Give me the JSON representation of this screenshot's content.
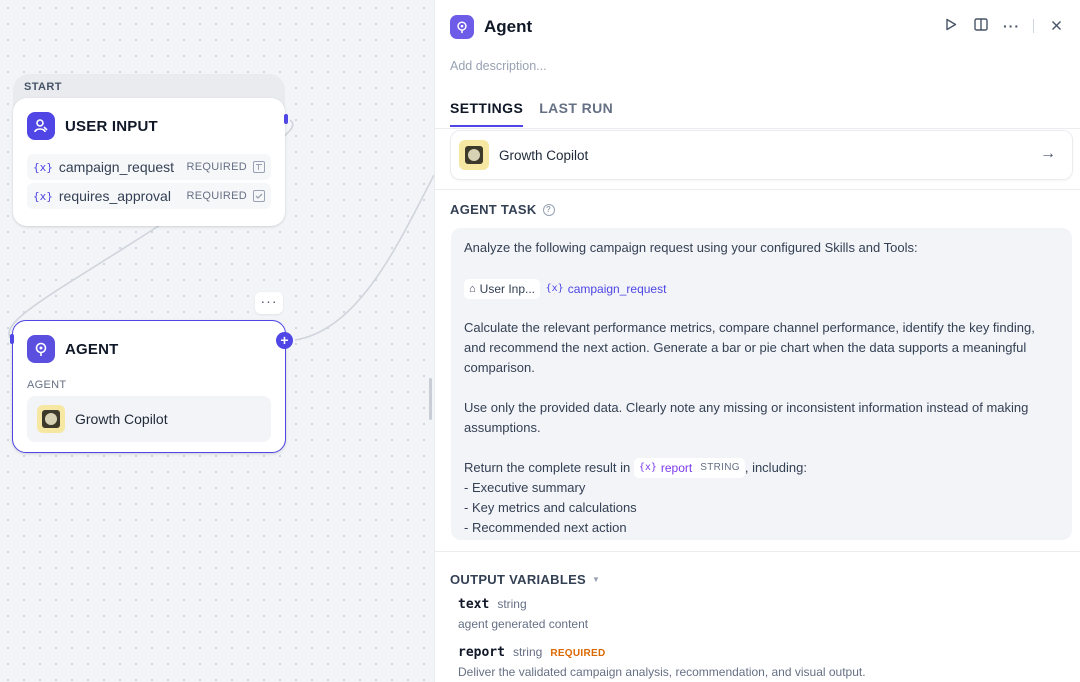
{
  "canvas": {
    "start_node": {
      "section_label": "START",
      "title": "USER INPUT",
      "icon": "user-input-icon",
      "variables": [
        {
          "name": "campaign_request",
          "required_label": "REQUIRED",
          "type_icon": "text-icon"
        },
        {
          "name": "requires_approval",
          "required_label": "REQUIRED",
          "type_icon": "checkbox-icon"
        }
      ]
    },
    "agent_node": {
      "title": "AGENT",
      "icon": "agent-icon",
      "section_label": "AGENT",
      "tool_name": "Growth Copilot",
      "more_label": "···"
    },
    "accent_color": "#4f46e5"
  },
  "panel": {
    "title": "Agent",
    "description_placeholder": "Add description...",
    "tabs": [
      {
        "label": "SETTINGS",
        "active": true
      },
      {
        "label": "LAST RUN",
        "active": false
      }
    ],
    "tool_card": {
      "name": "Growth Copilot"
    },
    "agent_task": {
      "title": "AGENT TASK",
      "intro": "Analyze the following campaign request using your configured Skills and Tools:",
      "chip_node": "User Inp...",
      "chip_var": "campaign_request",
      "para1": "Calculate the relevant performance metrics, compare channel performance, identify the key finding, and recommend the next action. Generate a bar or pie chart when the data supports a meaningful comparison.",
      "para2": "Use only the provided data. Clearly note any missing or inconsistent information instead of making assumptions.",
      "return_prefix": "Return the complete result in",
      "return_var": "report",
      "return_var_type": "STRING",
      "return_suffix": ", including:",
      "bullets": [
        "- Executive summary",
        "- Key metrics and calculations",
        "- Recommended next action"
      ]
    },
    "output_variables": {
      "title": "OUTPUT VARIABLES",
      "items": [
        {
          "name": "text",
          "type": "string",
          "required": "",
          "description": "agent generated content"
        },
        {
          "name": "report",
          "type": "string",
          "required": "REQUIRED",
          "description": "Deliver the validated campaign analysis, recommendation, and visual output."
        }
      ]
    }
  }
}
